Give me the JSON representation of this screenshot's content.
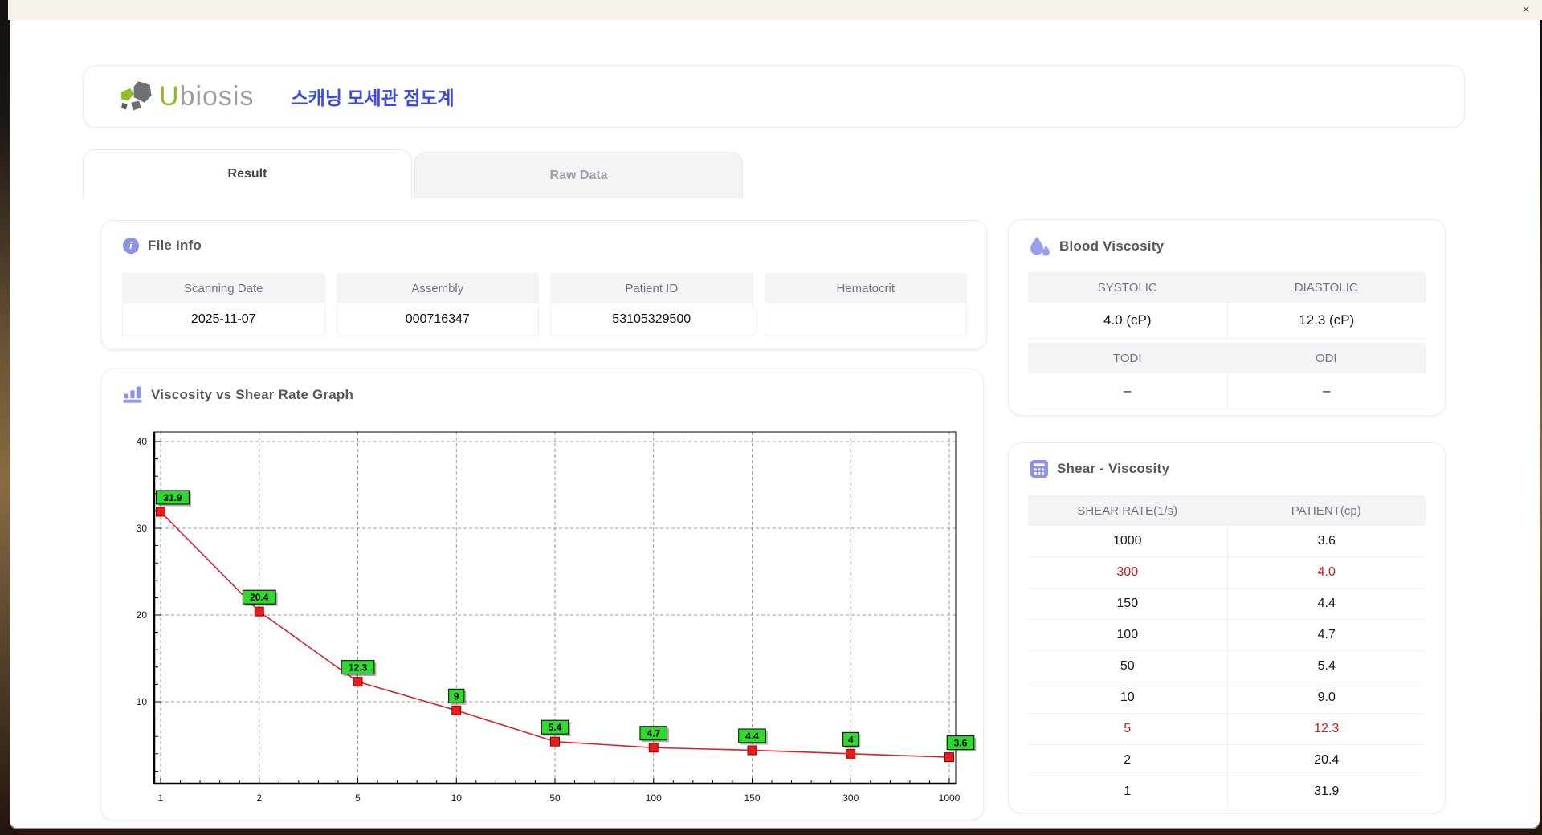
{
  "titlebar": {
    "close_glyph": "×"
  },
  "header": {
    "logo_u": "U",
    "logo_rest": "biosis",
    "app_title": "스캐닝 모세관 점도계"
  },
  "tabs": {
    "result": "Result",
    "raw_data": "Raw Data"
  },
  "file_info": {
    "title": "File Info",
    "info_glyph": "i",
    "fields": [
      {
        "label": "Scanning Date",
        "value": "2025-11-07"
      },
      {
        "label": "Assembly",
        "value": "000716347"
      },
      {
        "label": "Patient ID",
        "value": "53105329500"
      },
      {
        "label": "Hematocrit",
        "value": ""
      }
    ]
  },
  "blood_viscosity": {
    "title": "Blood Viscosity",
    "groups": [
      {
        "cols": [
          {
            "label": "SYSTOLIC",
            "value": "4.0 (cP)"
          },
          {
            "label": "DIASTOLIC",
            "value": "12.3 (cP)"
          }
        ]
      },
      {
        "cols": [
          {
            "label": "TODI",
            "value": "–"
          },
          {
            "label": "ODI",
            "value": "–"
          }
        ]
      }
    ]
  },
  "graph": {
    "title": "Viscosity vs Shear Rate Graph"
  },
  "shear_viscosity": {
    "title": "Shear - Viscosity",
    "columns": [
      "SHEAR RATE(1/s)",
      "PATIENT(cp)"
    ],
    "rows": [
      {
        "shear_rate": "1000",
        "patient": "3.6",
        "highlight": false
      },
      {
        "shear_rate": "300",
        "patient": "4.0",
        "highlight": true
      },
      {
        "shear_rate": "150",
        "patient": "4.4",
        "highlight": false
      },
      {
        "shear_rate": "100",
        "patient": "4.7",
        "highlight": false
      },
      {
        "shear_rate": "50",
        "patient": "5.4",
        "highlight": false
      },
      {
        "shear_rate": "10",
        "patient": "9.0",
        "highlight": false
      },
      {
        "shear_rate": "5",
        "patient": "12.3",
        "highlight": true
      },
      {
        "shear_rate": "2",
        "patient": "20.4",
        "highlight": false
      },
      {
        "shear_rate": "1",
        "patient": "31.9",
        "highlight": false
      }
    ]
  },
  "chart_data": {
    "type": "line",
    "title": "Viscosity vs Shear Rate Graph",
    "x": [
      "1",
      "2",
      "5",
      "10",
      "50",
      "100",
      "150",
      "300",
      "1000"
    ],
    "series": [
      {
        "name": "PATIENT(cp)",
        "values": [
          31.9,
          20.4,
          12.3,
          9,
          5.4,
          4.7,
          4.4,
          4,
          3.6
        ]
      }
    ],
    "point_labels": [
      "31.9",
      "20.4",
      "12.3",
      "9",
      "5.4",
      "4.7",
      "4.4",
      "4",
      "3.6"
    ],
    "xlabel": "",
    "ylabel": "",
    "ylim": [
      0,
      42
    ],
    "yticks": [
      10,
      20,
      30,
      40
    ],
    "grid": true,
    "x_scale": "categorical",
    "legend": "none",
    "line_color": "#d91f2c",
    "marker_color": "#e81c1c",
    "marker_border": "#8f0000",
    "label_bg": "#30d930"
  },
  "colors": {
    "accent_purple": "#8b93e8",
    "title_blue": "#3b4be8",
    "logo_green": "#8cbd22",
    "highlight_red": "#cd1a1a",
    "titlebar_beige": "#f7f2ea"
  }
}
